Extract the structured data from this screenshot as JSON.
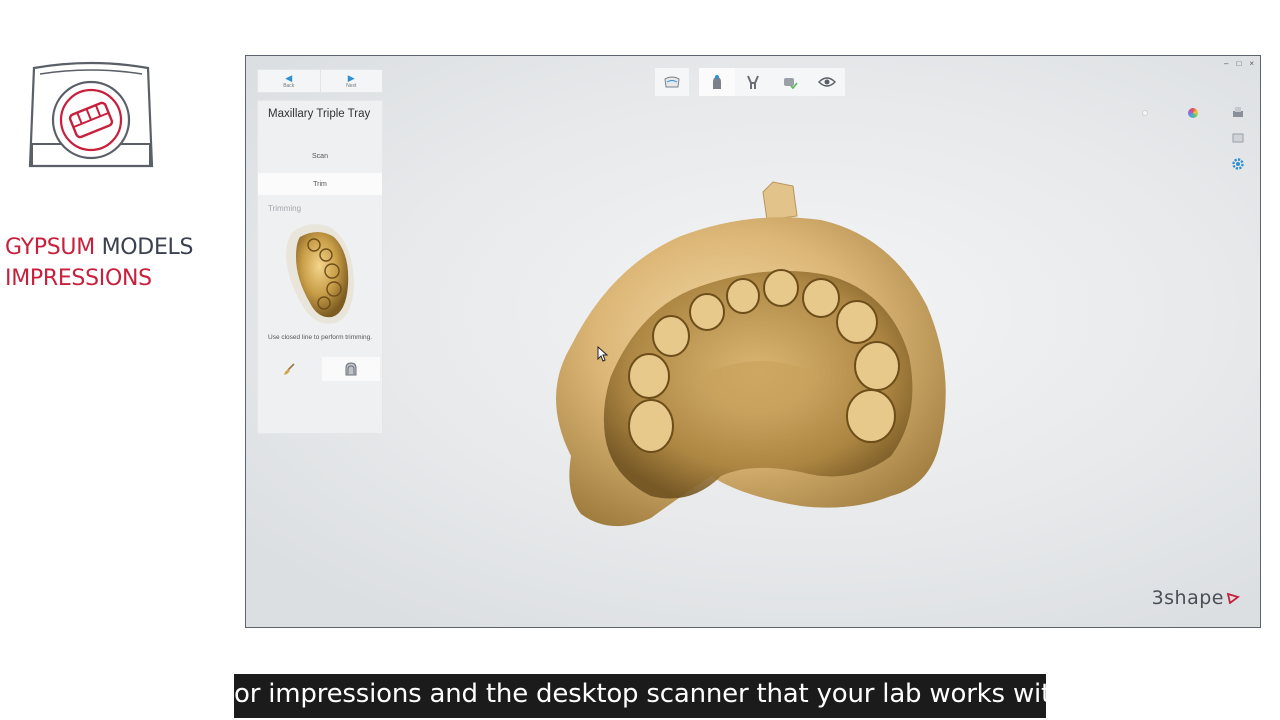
{
  "brand": {
    "word1_red": "GYPSUM",
    "word2_dark": "MODELS",
    "line2_red": "IMPRESSIONS",
    "accent_color": "#c8203c",
    "dark_color": "#3b4150",
    "logo_icon": "scanner-with-dental-model-icon"
  },
  "app": {
    "nav": {
      "back_label": "Back",
      "next_label": "Next"
    },
    "panel": {
      "title": "Maxillary Triple Tray",
      "steps": [
        {
          "label": "Scan"
        },
        {
          "label": "Trim"
        }
      ],
      "section_label": "Trimming",
      "hint": "Use closed line to perform trimming.",
      "tools": [
        "brush-icon",
        "jaw-model-icon"
      ]
    },
    "topbar_icons": [
      "tray-icon",
      "tooth-model-icon",
      "articulator-icon",
      "check-model-icon",
      "eye-icon"
    ],
    "right_icons": [
      "print-icon",
      "view-icon",
      "settings-icon"
    ],
    "logo_text": "3shape",
    "logo_color": "#c8203c"
  },
  "caption": {
    "text": "or impressions and the desktop scanner that your lab works with."
  }
}
